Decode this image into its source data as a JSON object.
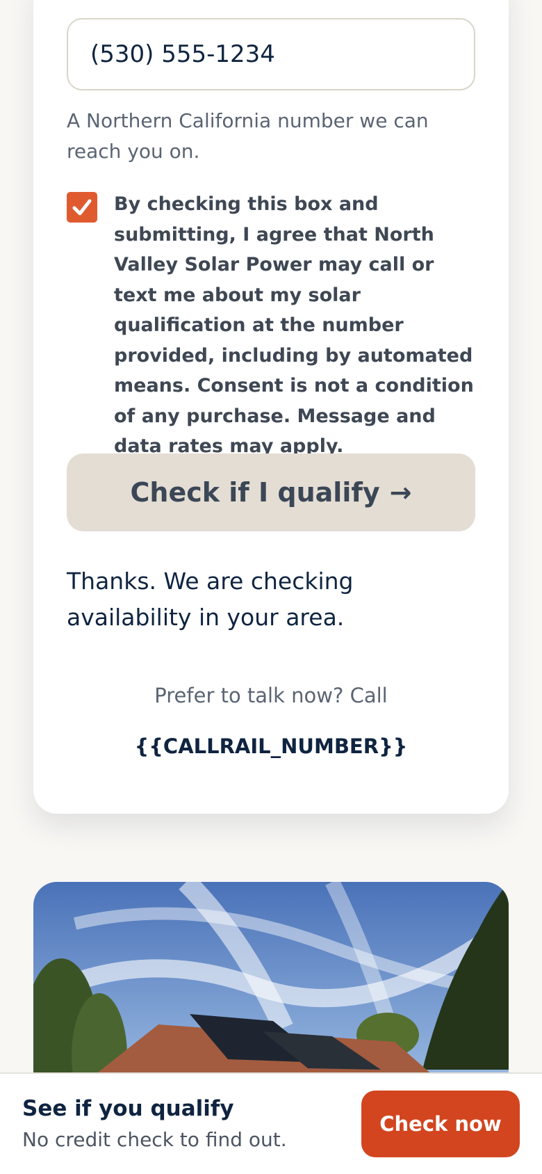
{
  "form": {
    "phone_value": "(530) 555-1234",
    "phone_helper": "A Northern California number we can reach you on.",
    "consent_text": "By checking this box and submitting, I agree that North Valley Solar Power may call or text me about my solar qualification at the number provided, including by automated means. Consent is not a condition of any purchase. Message and data rates may apply.",
    "consent_checked": true,
    "submit_label": "Check if I qualify",
    "submit_arrow": "→",
    "thanks_message": "Thanks. We are checking availability in your area.",
    "prefer_text": "Prefer to talk now? Call",
    "call_number": "{{CALLRAIL_NUMBER}}"
  },
  "photo": {
    "alt": "House with rooftop solar panels under a blue sky"
  },
  "sticky_bar": {
    "title": "See if you qualify",
    "subtitle": "No credit check to find out.",
    "cta_label": "Check now"
  },
  "colors": {
    "accent": "#e05a30",
    "cta": "#d2451f",
    "navy": "#0f2440",
    "muted_button": "#e4ddd3"
  },
  "icons": {
    "checkbox": "checkmark-icon",
    "submit_arrow": "arrow-right-icon"
  }
}
